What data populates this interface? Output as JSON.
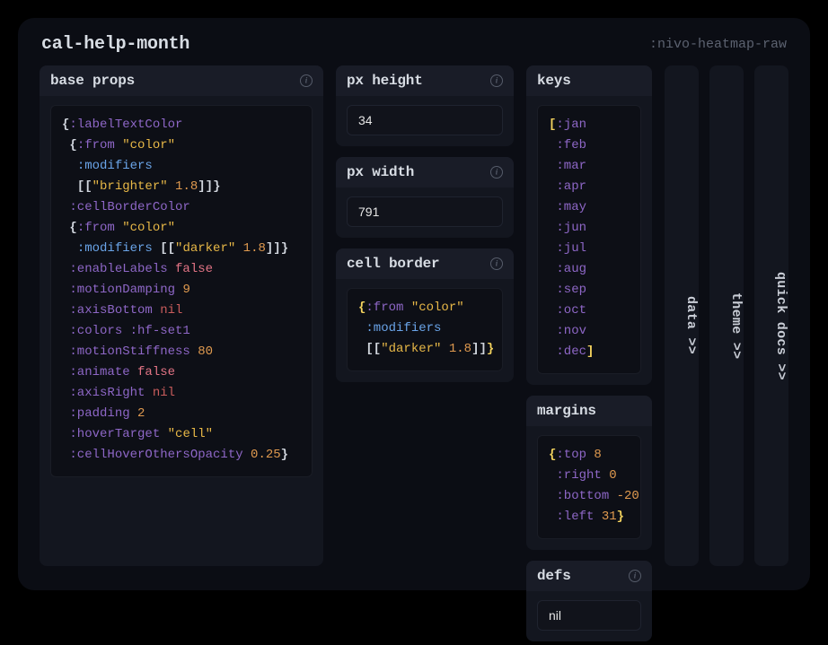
{
  "header": {
    "title": "cal-help-month",
    "component": ":nivo-heatmap-raw"
  },
  "panels": {
    "baseProps": {
      "title": "base props",
      "tokens": [
        [
          "pun",
          "{"
        ],
        [
          "kw",
          ":labelTextColor"
        ],
        [
          "nl"
        ],
        [
          "sp",
          " "
        ],
        [
          "pun",
          "{"
        ],
        [
          "kw",
          ":from"
        ],
        [
          "sp",
          " "
        ],
        [
          "str",
          "\"color\""
        ],
        [
          "nl"
        ],
        [
          "sp",
          "  "
        ],
        [
          "mod",
          ":modifiers"
        ],
        [
          "nl"
        ],
        [
          "sp",
          "  "
        ],
        [
          "pun",
          "[["
        ],
        [
          "str",
          "\"brighter\""
        ],
        [
          "sp",
          " "
        ],
        [
          "num",
          "1.8"
        ],
        [
          "pun",
          "]]}"
        ],
        [
          "nl"
        ],
        [
          "sp",
          " "
        ],
        [
          "kw",
          ":cellBorderColor"
        ],
        [
          "nl"
        ],
        [
          "sp",
          " "
        ],
        [
          "pun",
          "{"
        ],
        [
          "kw",
          ":from"
        ],
        [
          "sp",
          " "
        ],
        [
          "str",
          "\"color\""
        ],
        [
          "nl"
        ],
        [
          "sp",
          "  "
        ],
        [
          "mod",
          ":modifiers"
        ],
        [
          "sp",
          " "
        ],
        [
          "pun",
          "[["
        ],
        [
          "str",
          "\"darker\""
        ],
        [
          "sp",
          " "
        ],
        [
          "num",
          "1.8"
        ],
        [
          "pun",
          "]]}"
        ],
        [
          "nl"
        ],
        [
          "sp",
          " "
        ],
        [
          "kw",
          ":enableLabels"
        ],
        [
          "sp",
          " "
        ],
        [
          "boolT",
          "false"
        ],
        [
          "nl"
        ],
        [
          "sp",
          " "
        ],
        [
          "kw",
          ":motionDamping"
        ],
        [
          "sp",
          " "
        ],
        [
          "num",
          "9"
        ],
        [
          "nl"
        ],
        [
          "sp",
          " "
        ],
        [
          "kw",
          ":axisBottom"
        ],
        [
          "sp",
          " "
        ],
        [
          "lit",
          "nil"
        ],
        [
          "nl"
        ],
        [
          "sp",
          " "
        ],
        [
          "kw",
          ":colors"
        ],
        [
          "sp",
          " "
        ],
        [
          "kw",
          ":hf-set1"
        ],
        [
          "nl"
        ],
        [
          "sp",
          " "
        ],
        [
          "kw",
          ":motionStiffness"
        ],
        [
          "sp",
          " "
        ],
        [
          "num",
          "80"
        ],
        [
          "nl"
        ],
        [
          "sp",
          " "
        ],
        [
          "kw",
          ":animate"
        ],
        [
          "sp",
          " "
        ],
        [
          "boolT",
          "false"
        ],
        [
          "nl"
        ],
        [
          "sp",
          " "
        ],
        [
          "kw",
          ":axisRight"
        ],
        [
          "sp",
          " "
        ],
        [
          "lit",
          "nil"
        ],
        [
          "nl"
        ],
        [
          "sp",
          " "
        ],
        [
          "kw",
          ":padding"
        ],
        [
          "sp",
          " "
        ],
        [
          "num",
          "2"
        ],
        [
          "nl"
        ],
        [
          "sp",
          " "
        ],
        [
          "kw",
          ":hoverTarget"
        ],
        [
          "sp",
          " "
        ],
        [
          "str",
          "\"cell\""
        ],
        [
          "nl"
        ],
        [
          "sp",
          " "
        ],
        [
          "kw",
          ":cellHoverOthersOpacity"
        ],
        [
          "sp",
          " "
        ],
        [
          "num",
          "0.25"
        ],
        [
          "pun",
          "}"
        ]
      ]
    },
    "pxHeight": {
      "title": "px height",
      "value": "34"
    },
    "pxWidth": {
      "title": "px width",
      "value": "791"
    },
    "cellBorder": {
      "title": "cell border",
      "tokens": [
        [
          "punY",
          "{"
        ],
        [
          "kw",
          ":from"
        ],
        [
          "sp",
          " "
        ],
        [
          "str",
          "\"color\""
        ],
        [
          "nl"
        ],
        [
          "sp",
          " "
        ],
        [
          "mod",
          ":modifiers"
        ],
        [
          "nl"
        ],
        [
          "sp",
          " "
        ],
        [
          "pun",
          "[["
        ],
        [
          "str",
          "\"darker\""
        ],
        [
          "sp",
          " "
        ],
        [
          "num",
          "1.8"
        ],
        [
          "pun",
          "]]"
        ],
        [
          "punY",
          "}"
        ]
      ]
    },
    "keys": {
      "title": "keys",
      "tokens": [
        [
          "punY",
          "["
        ],
        [
          "kw",
          ":jan"
        ],
        [
          "nl"
        ],
        [
          "sp",
          " "
        ],
        [
          "kw",
          ":feb"
        ],
        [
          "nl"
        ],
        [
          "sp",
          " "
        ],
        [
          "kw",
          ":mar"
        ],
        [
          "nl"
        ],
        [
          "sp",
          " "
        ],
        [
          "kw",
          ":apr"
        ],
        [
          "nl"
        ],
        [
          "sp",
          " "
        ],
        [
          "kw",
          ":may"
        ],
        [
          "nl"
        ],
        [
          "sp",
          " "
        ],
        [
          "kw",
          ":jun"
        ],
        [
          "nl"
        ],
        [
          "sp",
          " "
        ],
        [
          "kw",
          ":jul"
        ],
        [
          "nl"
        ],
        [
          "sp",
          " "
        ],
        [
          "kw",
          ":aug"
        ],
        [
          "nl"
        ],
        [
          "sp",
          " "
        ],
        [
          "kw",
          ":sep"
        ],
        [
          "nl"
        ],
        [
          "sp",
          " "
        ],
        [
          "kw",
          ":oct"
        ],
        [
          "nl"
        ],
        [
          "sp",
          " "
        ],
        [
          "kw",
          ":nov"
        ],
        [
          "nl"
        ],
        [
          "sp",
          " "
        ],
        [
          "kw",
          ":dec"
        ],
        [
          "punY",
          "]"
        ]
      ]
    },
    "margins": {
      "title": "margins",
      "tokens": [
        [
          "punY",
          "{"
        ],
        [
          "kw",
          ":top"
        ],
        [
          "sp",
          " "
        ],
        [
          "num",
          "8"
        ],
        [
          "nl"
        ],
        [
          "sp",
          " "
        ],
        [
          "kw",
          ":right"
        ],
        [
          "sp",
          " "
        ],
        [
          "num",
          "0"
        ],
        [
          "nl"
        ],
        [
          "sp",
          " "
        ],
        [
          "kw",
          ":bottom"
        ],
        [
          "sp",
          " "
        ],
        [
          "num",
          "-20"
        ],
        [
          "nl"
        ],
        [
          "sp",
          " "
        ],
        [
          "kw",
          ":left"
        ],
        [
          "sp",
          " "
        ],
        [
          "num",
          "31"
        ],
        [
          "punY",
          "}"
        ]
      ]
    },
    "defs": {
      "title": "defs",
      "value": "nil"
    }
  },
  "sideTabs": {
    "data": "data >>",
    "theme": "theme >>",
    "quickDocs": "quick docs >>"
  }
}
